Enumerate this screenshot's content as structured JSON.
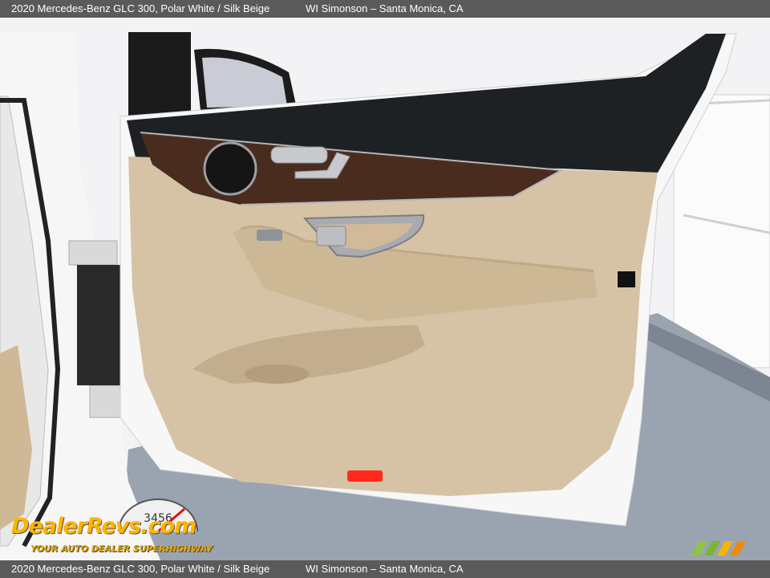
{
  "caption": {
    "title": "2020 Mercedes-Benz GLC 300,  Polar White / Silk Beige",
    "dealer": "WI Simonson – Santa Monica, CA"
  },
  "watermark": {
    "logo_text": "DealerRevs.com",
    "tagline": "YOUR AUTO DEALER SUPERHIGHWAY",
    "gauge_digits": "3456"
  },
  "colors": {
    "caption_bar": "#5a5a5a",
    "door_trim": "#d6c3a5",
    "wood_trim": "#4a2c1e",
    "floor": "#9aa3b0",
    "watermark_gold": "#ffb400",
    "brand_green": "#8cc63f"
  }
}
